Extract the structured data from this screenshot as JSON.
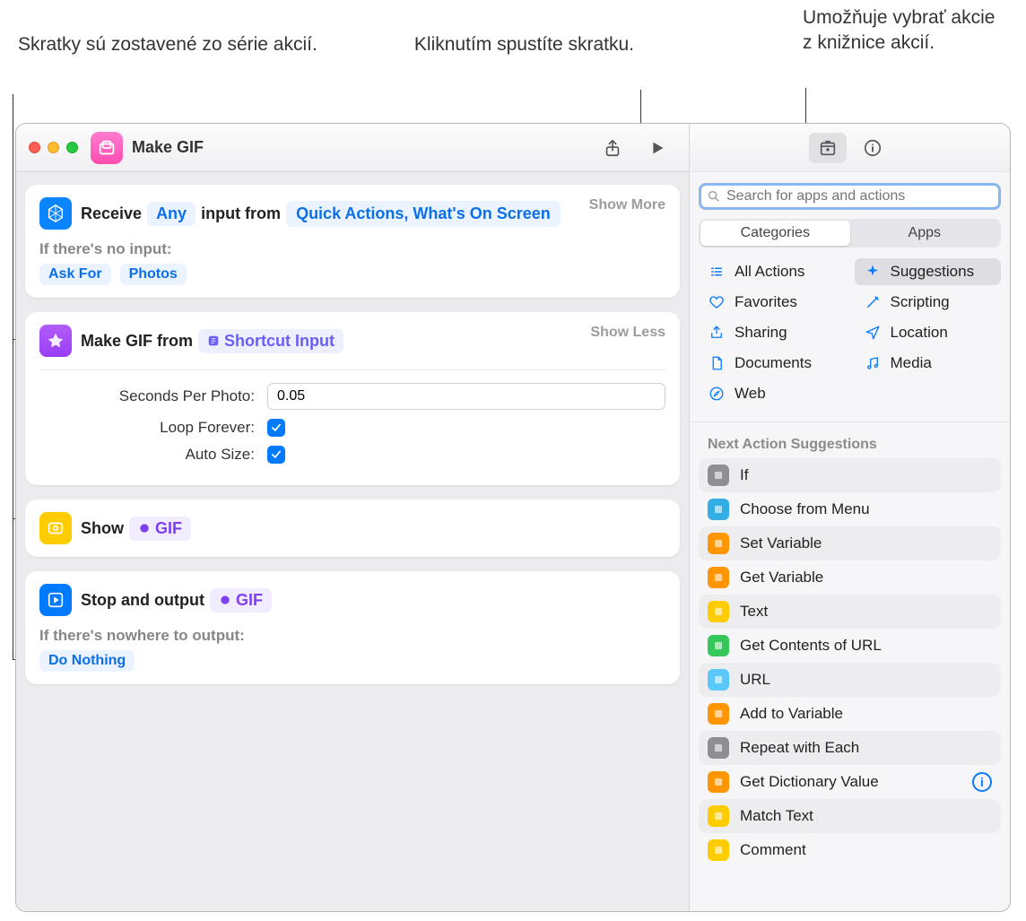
{
  "annotations": {
    "left": "Skratky sú zostavené zo série akcií.",
    "middle": "Kliknutím spustíte skratku.",
    "right": "Umožňuje vybrať akcie z knižnice akcií."
  },
  "window": {
    "title": "Make GIF"
  },
  "receive": {
    "prefix": "Receive",
    "any": "Any",
    "mid": "input from",
    "source": "Quick Actions, What's On Screen",
    "show_more": "Show More",
    "no_input_label": "If there's no input:",
    "ask_for": "Ask For",
    "photos": "Photos"
  },
  "makegif": {
    "prefix": "Make GIF from",
    "var": "Shortcut Input",
    "show_less": "Show Less",
    "params": {
      "seconds_label": "Seconds Per Photo:",
      "seconds_value": "0.05",
      "loop_label": "Loop Forever:",
      "auto_label": "Auto Size:"
    }
  },
  "show": {
    "prefix": "Show",
    "var": "GIF"
  },
  "stop": {
    "prefix": "Stop and output",
    "var": "GIF",
    "nowhere_label": "If there's nowhere to output:",
    "do_nothing": "Do Nothing"
  },
  "sidebar": {
    "search_placeholder": "Search for apps and actions",
    "seg_categories": "Categories",
    "seg_apps": "Apps",
    "categories": {
      "all_actions": "All Actions",
      "suggestions": "Suggestions",
      "favorites": "Favorites",
      "scripting": "Scripting",
      "sharing": "Sharing",
      "location": "Location",
      "documents": "Documents",
      "media": "Media",
      "web": "Web"
    },
    "suggestions_header": "Next Action Suggestions",
    "suggestions": [
      {
        "label": "If",
        "color": "#8e8e93"
      },
      {
        "label": "Choose from Menu",
        "color": "#32ade6"
      },
      {
        "label": "Set Variable",
        "color": "#ff9500"
      },
      {
        "label": "Get Variable",
        "color": "#ff9500"
      },
      {
        "label": "Text",
        "color": "#ffcc00"
      },
      {
        "label": "Get Contents of URL",
        "color": "#34c759"
      },
      {
        "label": "URL",
        "color": "#5ac8fa"
      },
      {
        "label": "Add to Variable",
        "color": "#ff9500"
      },
      {
        "label": "Repeat with Each",
        "color": "#8e8e93"
      },
      {
        "label": "Get Dictionary Value",
        "color": "#ff9500",
        "info": true
      },
      {
        "label": "Match Text",
        "color": "#ffcc00"
      },
      {
        "label": "Comment",
        "color": "#ffcc00"
      }
    ]
  }
}
